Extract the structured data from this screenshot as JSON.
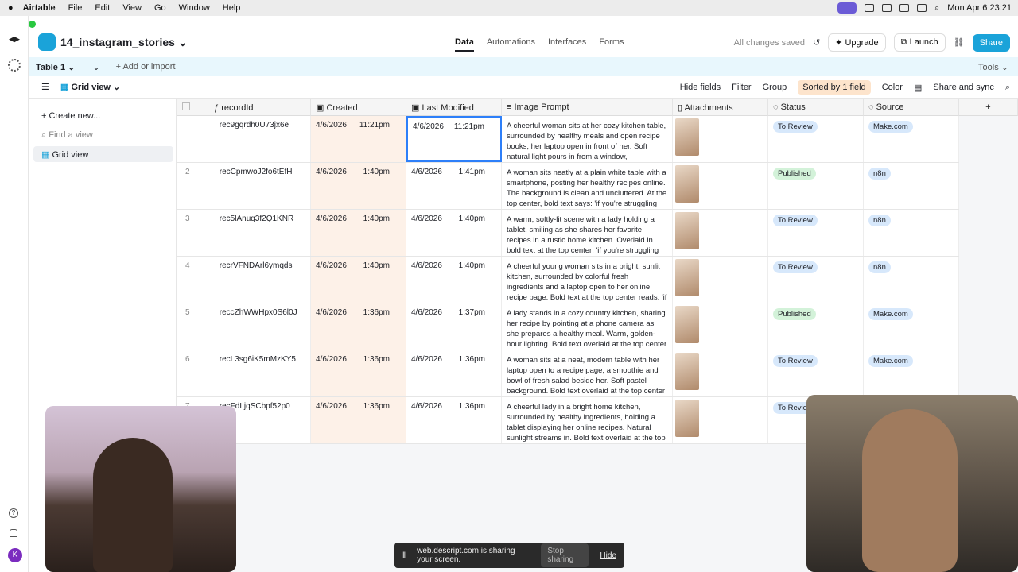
{
  "menubar": {
    "app": "Airtable",
    "items": [
      "File",
      "Edit",
      "View",
      "Go",
      "Window",
      "Help"
    ],
    "clock": "Mon Apr 6  23:21"
  },
  "header": {
    "base_name": "14_instagram_stories",
    "tabs": [
      "Data",
      "Automations",
      "Interfaces",
      "Forms"
    ],
    "saved": "All changes saved",
    "upgrade": "Upgrade",
    "launch": "Launch",
    "share": "Share"
  },
  "tablebar": {
    "table": "Table 1",
    "add": "Add or import",
    "tools": "Tools"
  },
  "viewbar": {
    "view": "Grid view",
    "hide": "Hide fields",
    "filter": "Filter",
    "group": "Group",
    "sorted": "Sorted by 1 field",
    "color": "Color",
    "share_sync": "Share and sync"
  },
  "sidebar": {
    "create": "Create new...",
    "find": "Find a view",
    "grid": "Grid view"
  },
  "columns": [
    "recordId",
    "Created",
    "Last Modified",
    "Image Prompt",
    "Attachments",
    "Status",
    "Source"
  ],
  "rows": [
    {
      "n": "",
      "id": "rec9gqrdh0U73jx6e",
      "cd": "4/6/2026",
      "ct": "11:21pm",
      "md": "4/6/2026",
      "mt": "11:21pm",
      "prompt": "A cheerful woman sits at her cozy kitchen table, surrounded by healthy meals and open recipe books, her laptop open in front of her. Soft natural light pours in from a window, highlighting the ...",
      "status": "To Review",
      "source": "Make.com"
    },
    {
      "n": "2",
      "id": "recCpmwoJ2fo6tEfH",
      "cd": "4/6/2026",
      "ct": "1:40pm",
      "md": "4/6/2026",
      "mt": "1:41pm",
      "prompt": "A woman sits neatly at a plain white table with a smartphone, posting her healthy recipes online. The background is clean and uncluttered. At the top center, bold text says: 'if you're struggling wi...",
      "status": "Published",
      "source": "n8n"
    },
    {
      "n": "3",
      "id": "rec5lAnuq3f2Q1KNR",
      "cd": "4/6/2026",
      "ct": "1:40pm",
      "md": "4/6/2026",
      "mt": "1:40pm",
      "prompt": "A warm, softly-lit scene with a lady holding a tablet, smiling as she shares her favorite recipes in a rustic home kitchen. Overlaid in bold text at the top center: 'if you're struggling with weight loss......",
      "status": "To Review",
      "source": "n8n"
    },
    {
      "n": "4",
      "id": "recrVFNDArl6ymqds",
      "cd": "4/6/2026",
      "ct": "1:40pm",
      "md": "4/6/2026",
      "mt": "1:40pm",
      "prompt": "A cheerful young woman sits in a bright, sunlit kitchen, surrounded by colorful fresh ingredients and a laptop open to her online recipe page. Bold text at the top center reads: 'if you're struggling ...",
      "status": "To Review",
      "source": "n8n"
    },
    {
      "n": "5",
      "id": "reccZhWWHpx0S6l0J",
      "cd": "4/6/2026",
      "ct": "1:36pm",
      "md": "4/6/2026",
      "mt": "1:37pm",
      "prompt": "A lady stands in a cozy country kitchen, sharing her recipe by pointing at a phone camera as she prepares a healthy meal. Warm, golden-hour lighting. Bold text overlaid at the top center read...",
      "status": "Published",
      "source": "Make.com"
    },
    {
      "n": "6",
      "id": "recL3sg6iK5mMzKY5",
      "cd": "4/6/2026",
      "ct": "1:36pm",
      "md": "4/6/2026",
      "mt": "1:36pm",
      "prompt": "A woman sits at a neat, modern table with her laptop open to a recipe page, a smoothie and bowl of fresh salad beside her. Soft pastel background. Bold text overlaid at the top center reads: 'if you'...",
      "status": "To Review",
      "source": "Make.com"
    },
    {
      "n": "7",
      "id": "recFdLjqSCbpf52p0",
      "cd": "4/6/2026",
      "ct": "1:36pm",
      "md": "4/6/2026",
      "mt": "1:36pm",
      "prompt": "A cheerful lady in a bright home kitchen, surrounded by healthy ingredients, holding a tablet displaying her online recipes. Natural sunlight streams in. Bold text overlaid at the top center ...",
      "status": "To Review",
      "source": ""
    }
  ],
  "sharebar": {
    "msg": "web.descript.com is sharing your screen.",
    "stop": "Stop sharing",
    "hide": "Hide"
  },
  "colors": {
    "accent": "#1aa3d9",
    "review_pill": "#d7e8fb",
    "published_pill": "#d3f2d9",
    "created_bg": "#fdf1e8"
  }
}
